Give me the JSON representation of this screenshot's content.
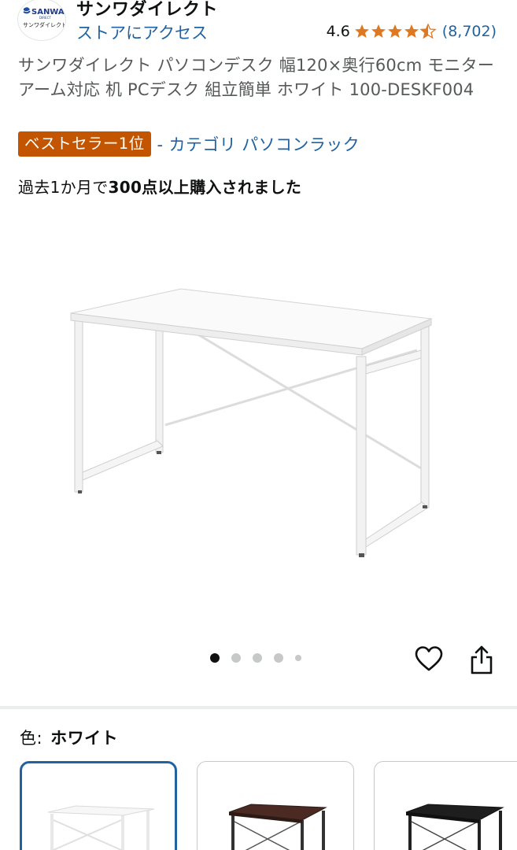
{
  "store": {
    "logo_text": "SANWA",
    "logo_sub": "サンワダイレクト",
    "name": "サンワダイレクト",
    "link_label": "ストアにアクセス"
  },
  "rating": {
    "value": "4.6",
    "stars": 4.5,
    "count": "(8,702)"
  },
  "product": {
    "title": "サンワダイレクト パソコンデスク 幅120×奥行60cm モニターアーム対応 机 PCデスク 組立簡単 ホワイト 100-DESKF004",
    "badge": "ベストセラー1位",
    "category_link": "- カテゴリ パソコンラック",
    "bought_prefix": "過去1か月で",
    "bought_emphasis": "300点以上購入されました"
  },
  "gallery": {
    "image_count": 5,
    "active_index": 0
  },
  "icons": {
    "favorite": "heart-icon",
    "share": "share-icon",
    "star": "star-icon"
  },
  "variants": {
    "label": "色:",
    "selected_value": "ホワイト",
    "options": [
      "white",
      "dark-brown",
      "black"
    ]
  },
  "colors": {
    "link": "#2162a1",
    "badge": "#c45500",
    "star": "#de7921",
    "selected_border": "#2162a1"
  }
}
